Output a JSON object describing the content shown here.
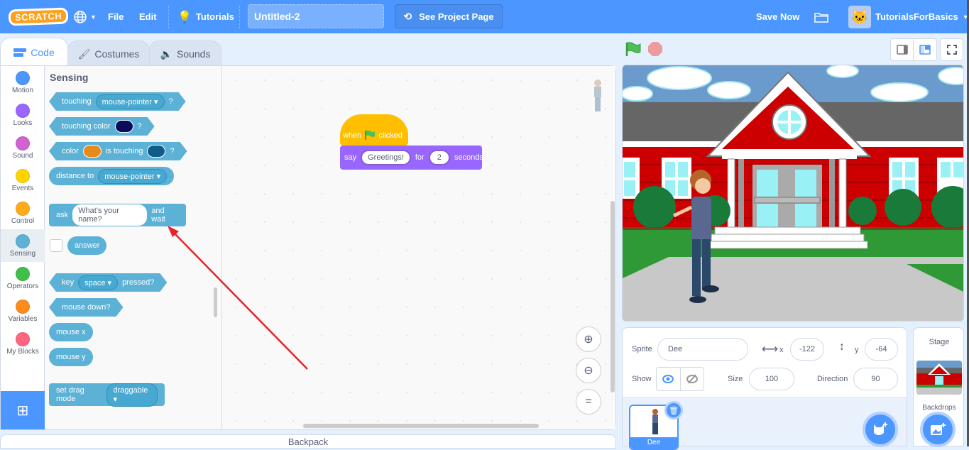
{
  "menubar": {
    "logo": "SCRATCH",
    "file": "File",
    "edit": "Edit",
    "tutorials": "Tutorials",
    "project_title": "Untitled-2",
    "see_project_page": "See Project Page",
    "save_now": "Save Now",
    "username": "TutorialsForBasics"
  },
  "tabs": [
    {
      "label": "Code",
      "icon": "code-icon",
      "active": true
    },
    {
      "label": "Costumes",
      "icon": "brush-icon",
      "active": false
    },
    {
      "label": "Sounds",
      "icon": "speaker-icon",
      "active": false
    }
  ],
  "categories": [
    {
      "label": "Motion",
      "color": "#4c97ff"
    },
    {
      "label": "Looks",
      "color": "#9966ff"
    },
    {
      "label": "Sound",
      "color": "#cf63cf"
    },
    {
      "label": "Events",
      "color": "#ffd500"
    },
    {
      "label": "Control",
      "color": "#ffab19"
    },
    {
      "label": "Sensing",
      "color": "#5cb1d6"
    },
    {
      "label": "Operators",
      "color": "#40bf4a"
    },
    {
      "label": "Variables",
      "color": "#ff8c1a"
    },
    {
      "label": "My Blocks",
      "color": "#ff6680"
    }
  ],
  "palette": {
    "title": "Sensing",
    "touching": {
      "label": "touching",
      "option": "mouse-pointer",
      "q": "?"
    },
    "touching_color": {
      "label": "touching color",
      "q": "?",
      "color": "#0b0b5c"
    },
    "color_touching": {
      "label1": "color",
      "label2": "is touching",
      "q": "?",
      "color1": "#e8891c",
      "color2": "#0f5b8a"
    },
    "distance": {
      "label": "distance to",
      "option": "mouse-pointer"
    },
    "ask": {
      "label1": "ask",
      "value": "What's your name?",
      "label2": "and wait"
    },
    "answer": "answer",
    "key_pressed": {
      "label1": "key",
      "option": "space",
      "label2": "pressed?"
    },
    "mouse_down": "mouse down?",
    "mouse_x": "mouse x",
    "mouse_y": "mouse y",
    "drag_mode": {
      "label": "set drag mode",
      "option": "draggable"
    }
  },
  "script": {
    "hat": {
      "label1": "when",
      "label2": "clicked"
    },
    "say": {
      "label1": "say",
      "message": "Greetings!",
      "label2": "for",
      "seconds": "2",
      "label3": "seconds"
    }
  },
  "backpack": "Backpack",
  "sprite_info": {
    "sprite_label": "Sprite",
    "sprite_name": "Dee",
    "x_label": "x",
    "x": "-122",
    "y_label": "y",
    "y": "-64",
    "show_label": "Show",
    "size_label": "Size",
    "size": "100",
    "direction_label": "Direction",
    "direction": "90"
  },
  "sprites": [
    {
      "name": "Dee",
      "selected": true
    }
  ],
  "stage_panel": {
    "title": "Stage",
    "backdrops_label": "Backdrops"
  }
}
